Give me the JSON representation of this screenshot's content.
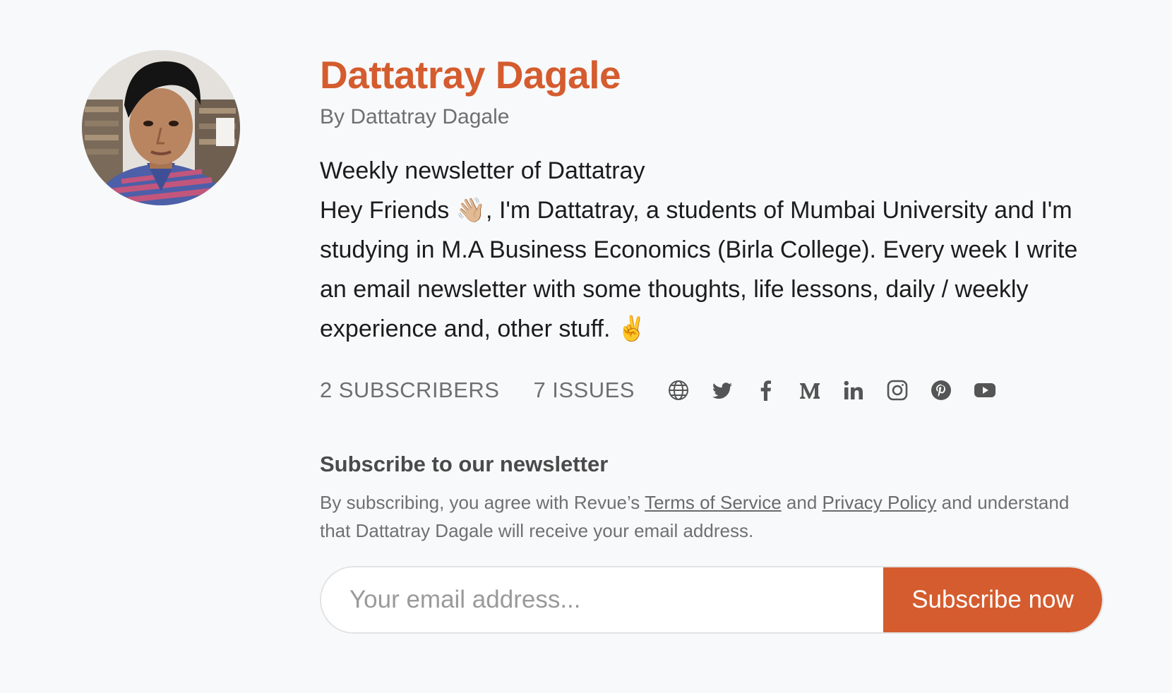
{
  "newsletter": {
    "title": "Dattatray Dagale",
    "byline": "By Dattatray Dagale",
    "description_heading": "Weekly newsletter of Dattatray",
    "description_body": "Hey Friends 👋🏼, I'm Dattatray, a students of Mumbai University and I'm studying in M.A Business Economics (Birla College). Every week I write an email newsletter with some thoughts, life lessons, daily / weekly experience and, other stuff. ✌️"
  },
  "stats": {
    "subscribers_count": "2",
    "subscribers_label": "SUBSCRIBERS",
    "issues_count": "7",
    "issues_label": "ISSUES"
  },
  "social_links": [
    "globe-icon",
    "twitter-icon",
    "facebook-icon",
    "medium-icon",
    "linkedin-icon",
    "instagram-icon",
    "pinterest-icon",
    "youtube-icon"
  ],
  "subscribe": {
    "heading": "Subscribe to our newsletter",
    "legal_prefix": "By subscribing, you agree with Revue’s",
    "terms_link": "Terms of Service",
    "legal_and": "and",
    "privacy_link": "Privacy Policy",
    "legal_suffix": "and understand that Dattatray Dagale will receive your email address.",
    "email_placeholder": "Your email address...",
    "button_label": "Subscribe now"
  },
  "colors": {
    "accent": "#d45c2e",
    "background": "#f8f9fb"
  }
}
